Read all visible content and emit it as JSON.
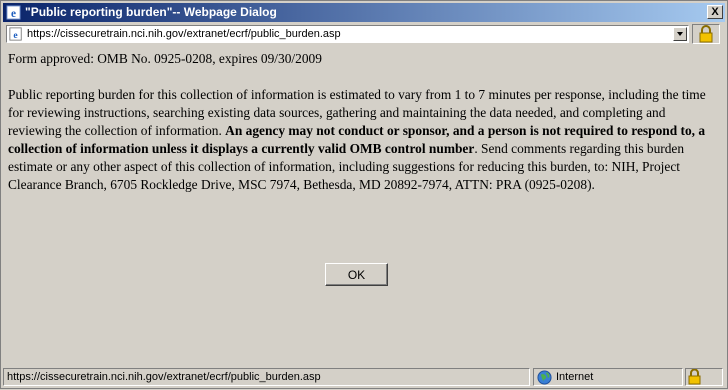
{
  "window": {
    "title": "\"Public reporting burden\"-- Webpage Dialog",
    "close_label": "X"
  },
  "address": {
    "url": "https://cissecuretrain.nci.nih.gov/extranet/ecrf/public_burden.asp"
  },
  "content": {
    "form_approved": "Form approved: OMB No. 0925-0208, expires 09/30/2009",
    "para_start": "Public reporting burden for this collection of information is estimated to vary from 1 to 7 minutes per response, including the time for reviewing instructions, searching existing data sources, gathering and maintaining the data needed, and completing and reviewing the collection of information. ",
    "para_bold": "An agency may not conduct or sponsor, and a person is not required to respond to, a collection of information unless it displays a currently valid OMB control number",
    "para_end": ". Send comments regarding this burden estimate or any other aspect of this collection of information, including suggestions for reducing this burden, to: NIH, Project Clearance Branch, 6705 Rockledge Drive, MSC 7974, Bethesda, MD 20892-7974, ATTN: PRA (0925-0208)."
  },
  "ok_button": {
    "label": "OK"
  },
  "status": {
    "url": "https://cissecuretrain.nci.nih.gov/extranet/ecrf/public_burden.asp",
    "zone": "Internet"
  },
  "icons": {
    "title": "ie-icon",
    "address": "ie-page-icon",
    "dropdown": "chevron-down-icon",
    "lock": "lock-icon",
    "zone": "globe-icon"
  },
  "colors": {
    "title_bar_start": "#0a246a",
    "title_bar_end": "#a6caf0",
    "face": "#d4d0c8"
  }
}
